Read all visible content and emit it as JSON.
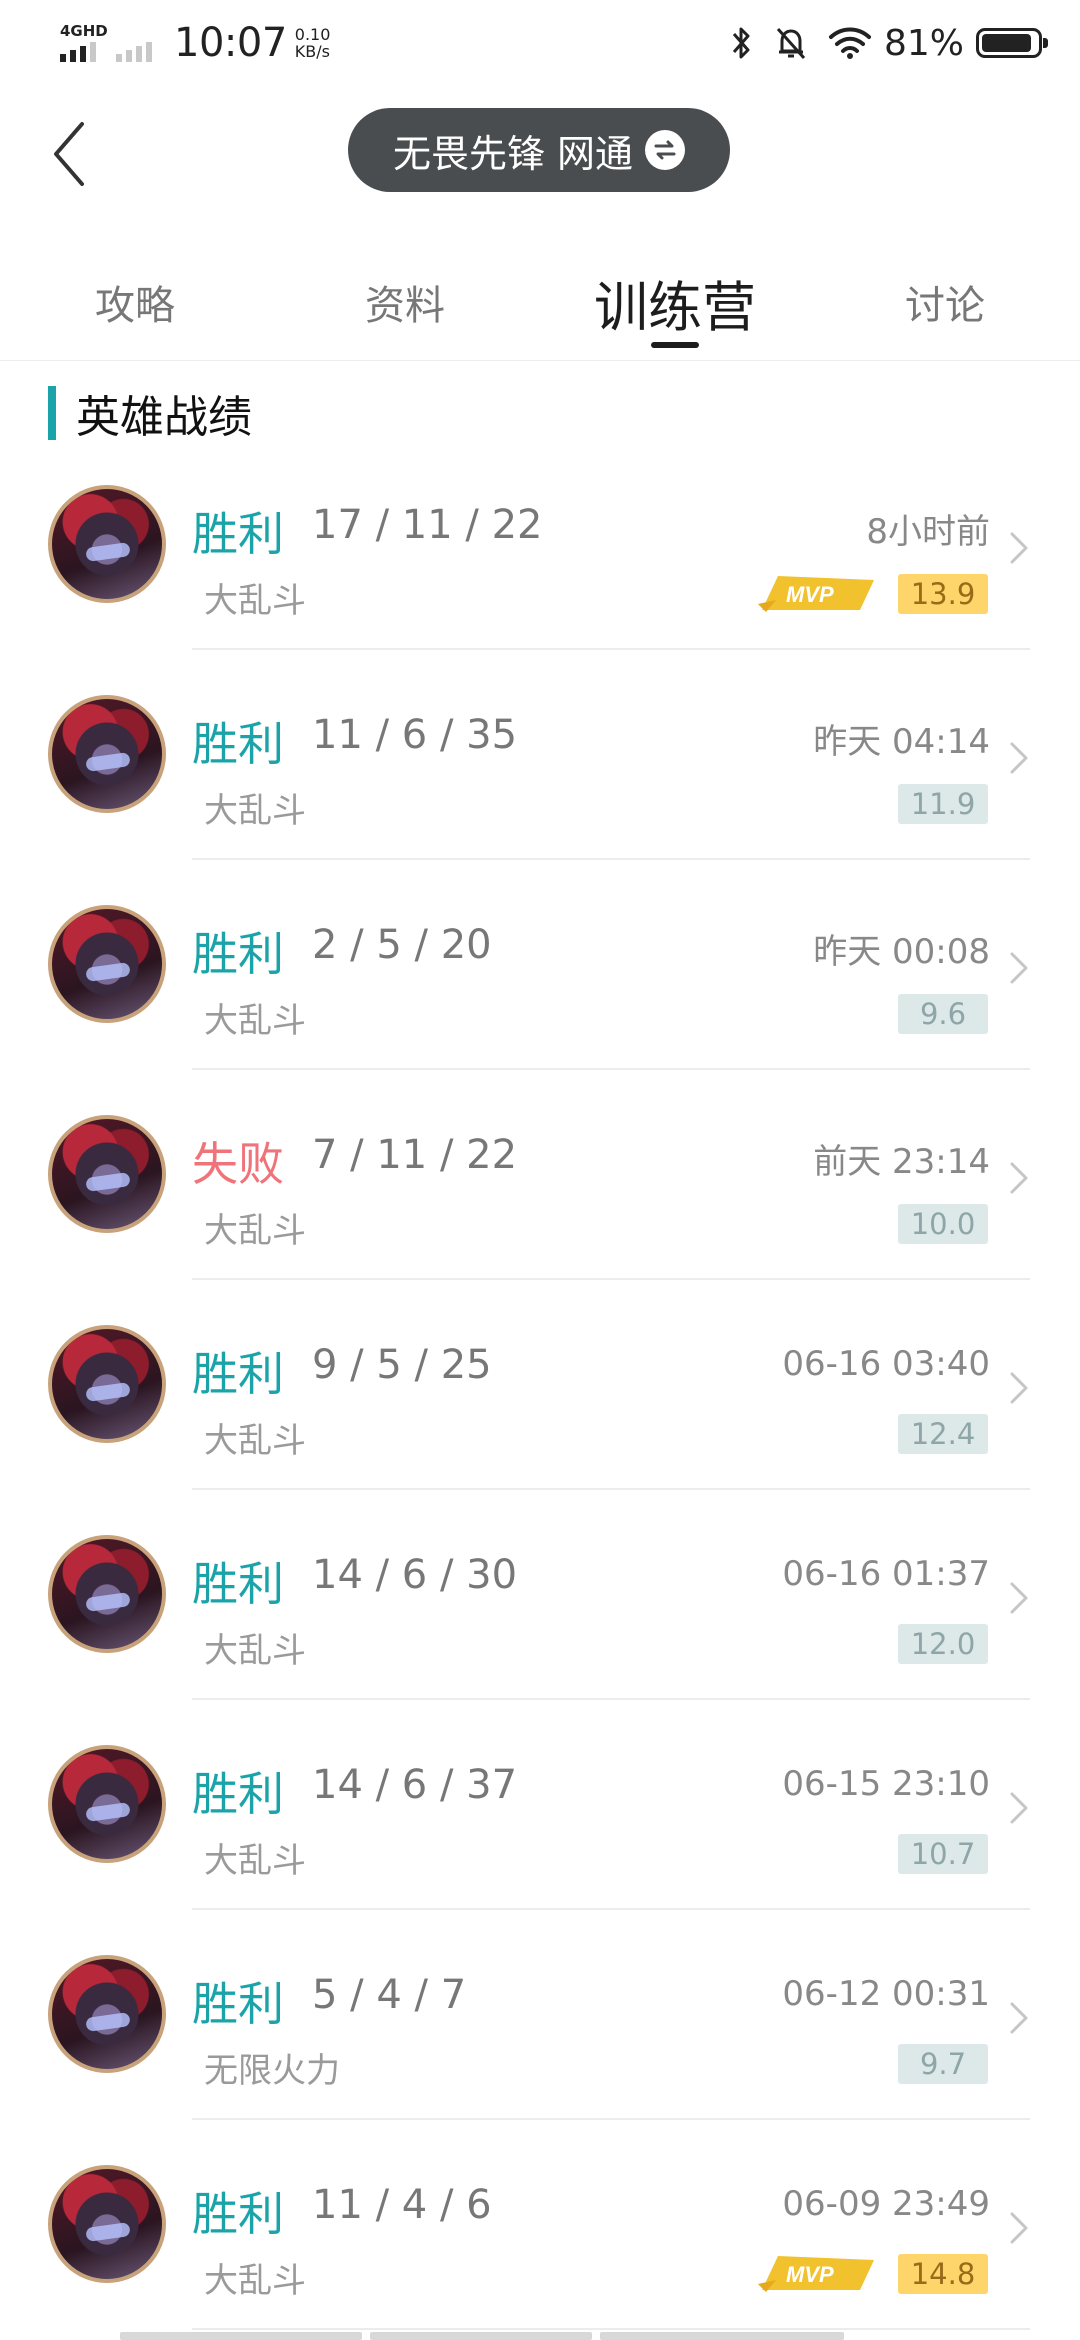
{
  "status_bar": {
    "network": "4GHD",
    "time": "10:07",
    "speed_value": "0.10",
    "speed_unit": "KB/s",
    "battery": "81%",
    "battery_level": 0.81,
    "icons": [
      "bluetooth-icon",
      "mute-icon",
      "wifi-icon",
      "battery-icon"
    ]
  },
  "header": {
    "back_icon": "chevron-left-icon",
    "account_label": "无畏先锋 网通",
    "switch_icon": "swap-icon"
  },
  "tabs": [
    {
      "label": "攻略",
      "active": false
    },
    {
      "label": "资料",
      "active": false
    },
    {
      "label": "训练营",
      "active": true
    },
    {
      "label": "讨论",
      "active": false
    }
  ],
  "section_title": "英雄战绩",
  "colors": {
    "accent": "#1aa3a8",
    "win": "#1aa3a8",
    "lose": "#f0737a",
    "mvp_score_bg": "#fed56b",
    "score_bg": "#dde8e8"
  },
  "records": [
    {
      "result": "胜利",
      "outcome": "win",
      "kda": "17 / 11 / 22",
      "mode": "大乱斗",
      "time": "8小时前",
      "score": "13.9",
      "mvp": true
    },
    {
      "result": "胜利",
      "outcome": "win",
      "kda": "11 / 6 / 35",
      "mode": "大乱斗",
      "time": "昨天 04:14",
      "score": "11.9",
      "mvp": false
    },
    {
      "result": "胜利",
      "outcome": "win",
      "kda": "2 / 5 / 20",
      "mode": "大乱斗",
      "time": "昨天 00:08",
      "score": "9.6",
      "mvp": false
    },
    {
      "result": "失败",
      "outcome": "lose",
      "kda": "7 / 11 / 22",
      "mode": "大乱斗",
      "time": "前天 23:14",
      "score": "10.0",
      "mvp": false
    },
    {
      "result": "胜利",
      "outcome": "win",
      "kda": "9 / 5 / 25",
      "mode": "大乱斗",
      "time": "06-16 03:40",
      "score": "12.4",
      "mvp": false
    },
    {
      "result": "胜利",
      "outcome": "win",
      "kda": "14 / 6 / 30",
      "mode": "大乱斗",
      "time": "06-16 01:37",
      "score": "12.0",
      "mvp": false
    },
    {
      "result": "胜利",
      "outcome": "win",
      "kda": "14 / 6 / 37",
      "mode": "大乱斗",
      "time": "06-15 23:10",
      "score": "10.7",
      "mvp": false
    },
    {
      "result": "胜利",
      "outcome": "win",
      "kda": "5 / 4 / 7",
      "mode": "无限火力",
      "time": "06-12 00:31",
      "score": "9.7",
      "mvp": false
    },
    {
      "result": "胜利",
      "outcome": "win",
      "kda": "11 / 4 / 6",
      "mode": "大乱斗",
      "time": "06-09 23:49",
      "score": "14.8",
      "mvp": true
    }
  ]
}
